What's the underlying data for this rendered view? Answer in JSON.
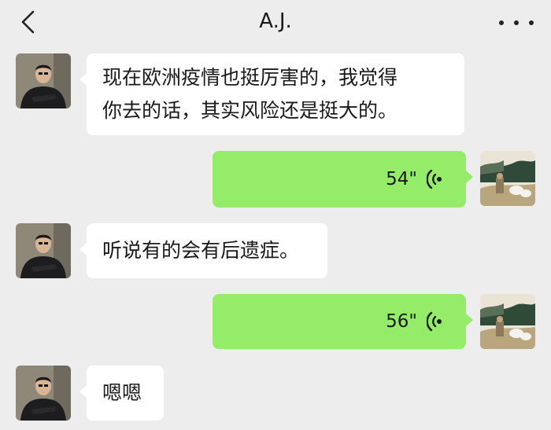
{
  "header": {
    "title": "A.J.",
    "back_icon": "chevron-left-icon",
    "more_icon": "more-dots-icon"
  },
  "messages": [
    {
      "from": "contact",
      "type": "text",
      "line1": "现在欧洲疫情也挺厉害的，我觉得",
      "line2": "你去的话，其实风险还是挺大的。"
    },
    {
      "from": "me",
      "type": "voice",
      "duration": "54\""
    },
    {
      "from": "contact",
      "type": "text",
      "text": "听说有的会有后遗症。"
    },
    {
      "from": "me",
      "type": "voice",
      "duration": "56\""
    },
    {
      "from": "contact",
      "type": "text",
      "text": "嗯嗯"
    }
  ],
  "colors": {
    "background": "#ededed",
    "incoming_bubble": "#ffffff",
    "outgoing_bubble": "#95ec69"
  }
}
